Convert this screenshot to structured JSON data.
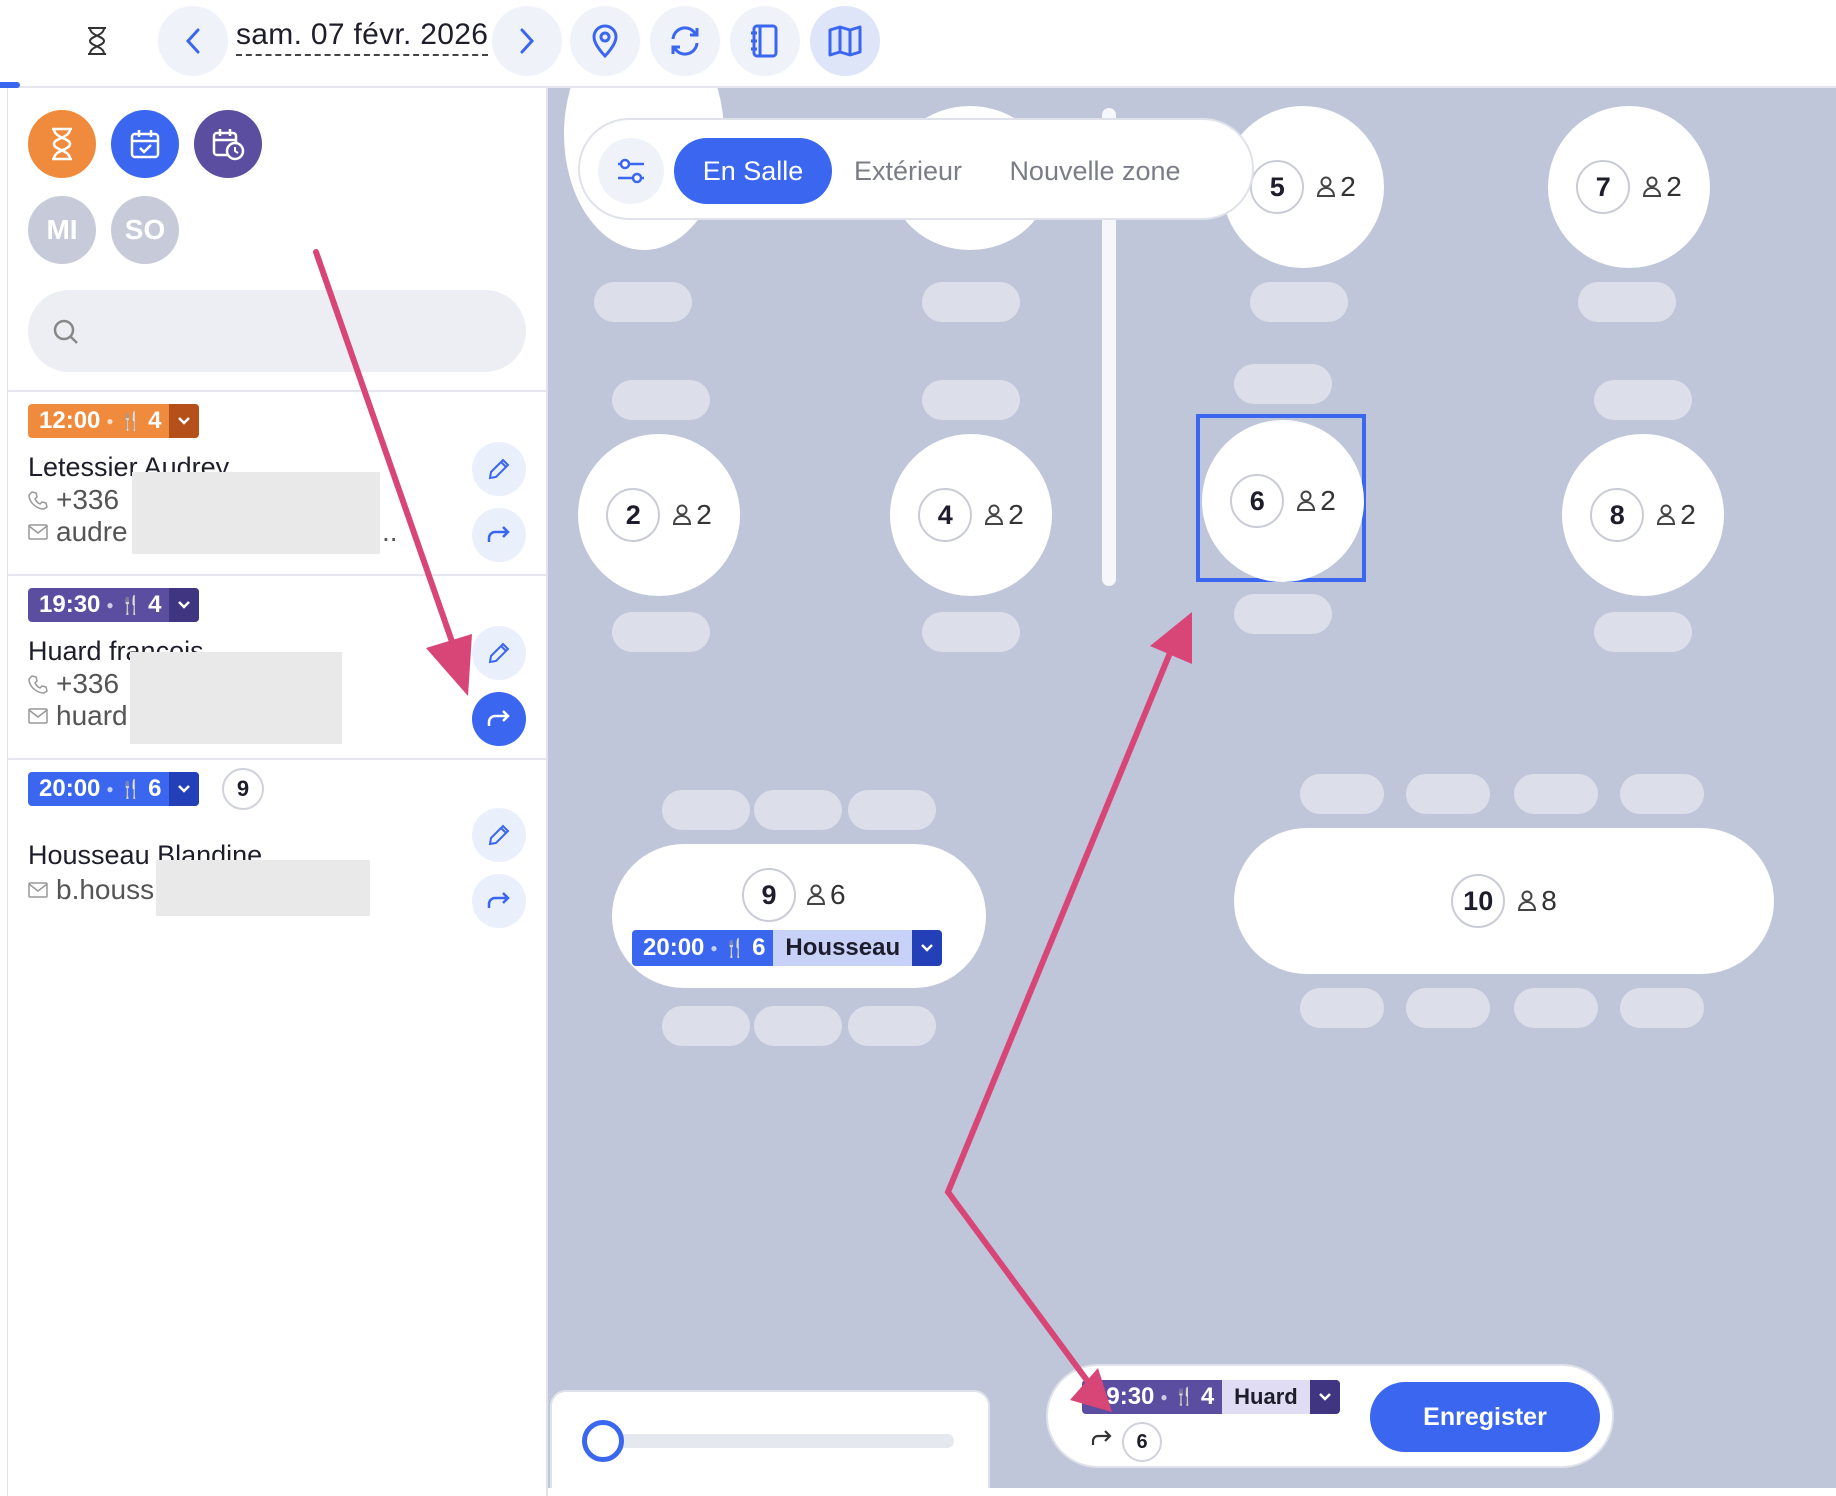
{
  "topbar": {
    "date": "sam. 07 févr. 2026",
    "icons": [
      "hourglass-icon",
      "chevron-left-icon",
      "chevron-right-icon",
      "location-pin-icon",
      "refresh-icon",
      "notebook-icon",
      "map-icon"
    ]
  },
  "sidebar": {
    "filters": [
      {
        "name": "waiting",
        "icon": "hourglass-icon",
        "color": "#f08a3c"
      },
      {
        "name": "booked",
        "icon": "calendar-check-icon",
        "color": "#3a66f0"
      },
      {
        "name": "scheduled",
        "icon": "calendar-clock-icon",
        "color": "#5b4ea0"
      }
    ],
    "services": [
      "MI",
      "SO"
    ],
    "search_placeholder": "",
    "reservations": [
      {
        "time": "12:00",
        "guests": "4",
        "color": "#f08a3c",
        "chev_color": "#b5501a",
        "name": "Letessier Audrey",
        "phone": "+336",
        "email": "audre",
        "email_suffix": ".."
      },
      {
        "time": "19:30",
        "guests": "4",
        "color": "#5b4ea0",
        "chev_color": "#403580",
        "name": "Huard francois",
        "phone": "+336",
        "email": "huard"
      },
      {
        "time": "20:00",
        "guests": "6",
        "color": "#3a66f0",
        "chev_color": "#2340b8",
        "table": "9",
        "name": "Housseau Blandine",
        "email": "b.houss"
      }
    ]
  },
  "zones": {
    "tabs": [
      "En Salle",
      "Extérieur",
      "Nouvelle zone"
    ],
    "active": "En Salle"
  },
  "floor": {
    "tables": [
      {
        "num": "5",
        "cap": "2"
      },
      {
        "num": "7",
        "cap": "2"
      },
      {
        "num": "2",
        "cap": "2"
      },
      {
        "num": "4",
        "cap": "2"
      },
      {
        "num": "6",
        "cap": "2",
        "selected": true
      },
      {
        "num": "8",
        "cap": "2"
      },
      {
        "num": "9",
        "cap": "6"
      },
      {
        "num": "10",
        "cap": "8"
      }
    ],
    "table9_booking": {
      "time": "20:00",
      "guests": "6",
      "name": "Housseau"
    }
  },
  "pending": {
    "time": "19:30",
    "guests": "4",
    "name": "Huard",
    "target_table": "6",
    "save_label": "Enregister"
  },
  "timeline": {
    "position": 0.0
  }
}
